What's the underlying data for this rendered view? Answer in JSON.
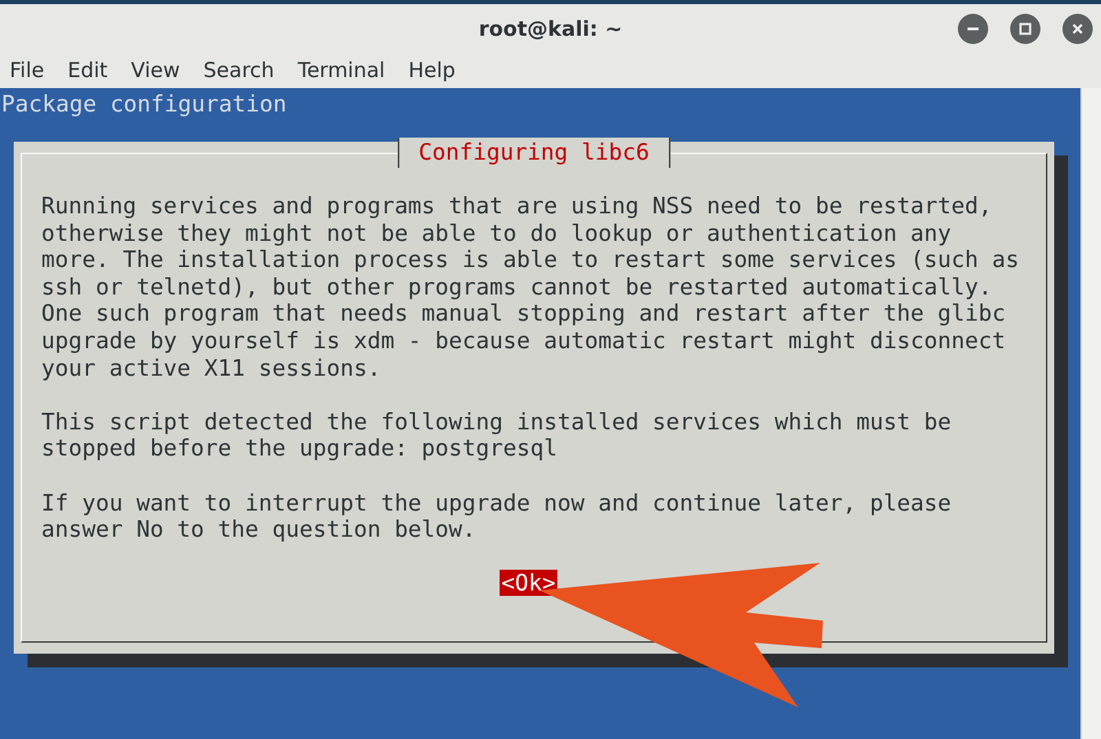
{
  "window": {
    "title": "root@kali: ~"
  },
  "menu": [
    "File",
    "Edit",
    "View",
    "Search",
    "Terminal",
    "Help"
  ],
  "terminal": {
    "header": "Package configuration",
    "dialog": {
      "title": "Configuring libc6",
      "paragraphs": [
        [
          "Running services and programs that are using NSS need to be restarted,",
          "otherwise they might not be able to do lookup or authentication any",
          "more. The installation process is able to restart some services (such as",
          "ssh or telnetd), but other programs cannot be restarted automatically.",
          "One such program that needs manual stopping and restart after the glibc",
          "upgrade by yourself is xdm - because automatic restart might disconnect",
          "your active X11 sessions."
        ],
        [
          "This script detected the following installed services which must be",
          "stopped before the upgrade: postgresql"
        ],
        [
          "If you want to interrupt the upgrade now and continue later, please",
          "answer No to the question below."
        ]
      ],
      "buttons": [
        {
          "label": "<Ok>",
          "selected": true
        }
      ]
    }
  }
}
